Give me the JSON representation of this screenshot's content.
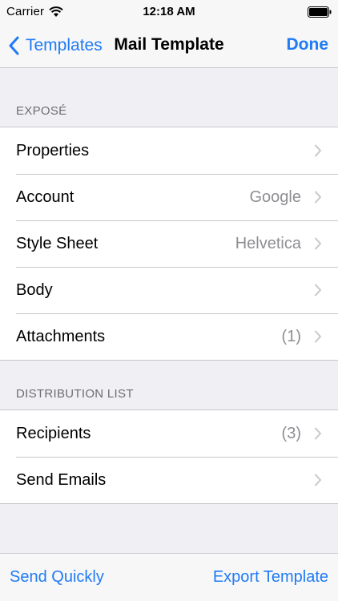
{
  "status_bar": {
    "carrier": "Carrier",
    "time": "12:18 AM",
    "icons": [
      "wifi-icon",
      "battery-icon"
    ]
  },
  "nav": {
    "back_label": "Templates",
    "title": "Mail Template",
    "done_label": "Done"
  },
  "sections": [
    {
      "header": "EXPOSÉ",
      "rows": [
        {
          "label": "Properties",
          "value": ""
        },
        {
          "label": "Account",
          "value": "Google"
        },
        {
          "label": "Style Sheet",
          "value": "Helvetica"
        },
        {
          "label": "Body",
          "value": ""
        },
        {
          "label": "Attachments",
          "value": "(1)"
        }
      ]
    },
    {
      "header": "DISTRIBUTION LIST",
      "rows": [
        {
          "label": "Recipients",
          "value": "(3)"
        },
        {
          "label": "Send Emails",
          "value": ""
        }
      ]
    }
  ],
  "toolbar": {
    "left_label": "Send Quickly",
    "right_label": "Export Template"
  },
  "colors": {
    "tint": "#1f7bf6",
    "background": "#efeff4",
    "bar": "#f7f7f7",
    "separator": "#c8c7cc",
    "secondary_text": "#8e8e93",
    "section_header": "#6d6d72"
  }
}
